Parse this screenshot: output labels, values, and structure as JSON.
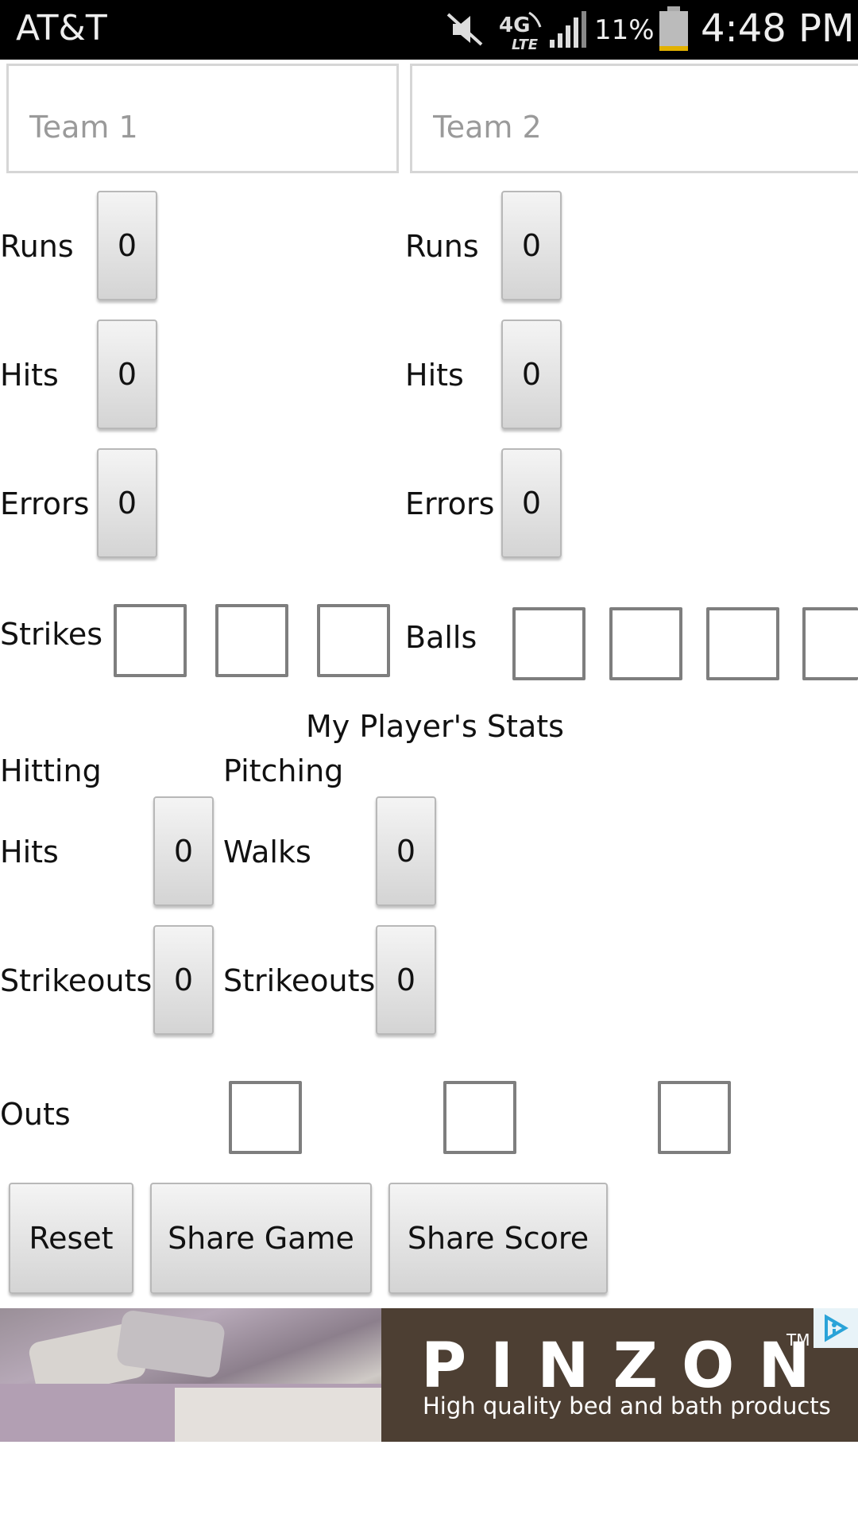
{
  "status_bar": {
    "carrier": "AT&T",
    "network": "4G LTE",
    "battery_percent": "11%",
    "time": "4:48 PM"
  },
  "teams": {
    "team1_placeholder": "Team 1",
    "team2_placeholder": "Team 2"
  },
  "team1": {
    "runs_label": "Runs",
    "runs_value": "0",
    "hits_label": "Hits",
    "hits_value": "0",
    "errors_label": "Errors",
    "errors_value": "0"
  },
  "team2": {
    "runs_label": "Runs",
    "runs_value": "0",
    "hits_label": "Hits",
    "hits_value": "0",
    "errors_label": "Errors",
    "errors_value": "0"
  },
  "count": {
    "strikes_label": "Strikes",
    "balls_label": "Balls"
  },
  "player_stats": {
    "title": "My Player's Stats",
    "hitting_header": "Hitting",
    "pitching_header": "Pitching",
    "hitting_hits_label": "Hits",
    "hitting_hits_value": "0",
    "hitting_strikeouts_label": "Strikeouts",
    "hitting_strikeouts_value": "0",
    "pitching_walks_label": "Walks",
    "pitching_walks_value": "0",
    "pitching_strikeouts_label": "Strikeouts",
    "pitching_strikeouts_value": "0"
  },
  "outs_label": "Outs",
  "actions": {
    "reset": "Reset",
    "share_game": "Share Game",
    "share_score": "Share Score"
  },
  "ad": {
    "brand": "PINZON",
    "tm": "TM",
    "tagline": "High quality bed and bath products"
  },
  "colors": {
    "status_bar_bg": "#000000",
    "button_face": "#e2e2e2",
    "ad_bg": "#4d3f33",
    "ad_choice_blue": "#2aa3d8"
  }
}
